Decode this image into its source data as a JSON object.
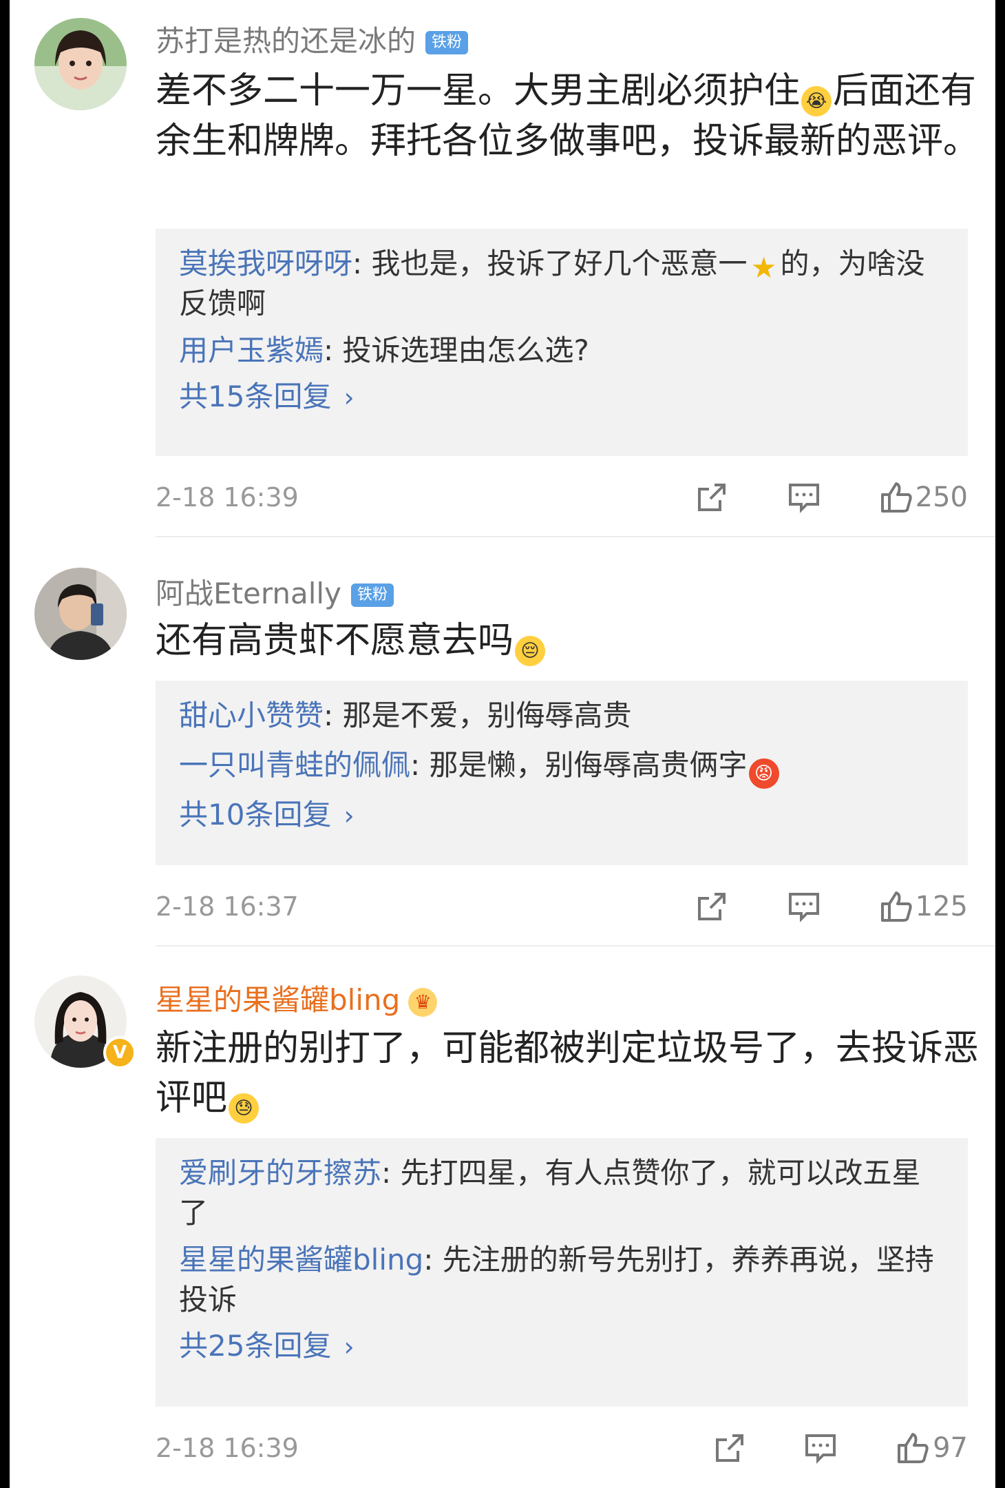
{
  "comments": [
    {
      "username": "苏打是热的还是冰的",
      "badge": "铁粉",
      "text_parts": [
        "差不多二十一万一星。大男主剧必须护住",
        "后面还有余生和牌牌。拜托各位多做事吧，投诉最新的恶评。"
      ],
      "emoji": "crying-emoji",
      "replies": [
        {
          "name": "莫挨我呀呀呀",
          "sep": ": ",
          "text_parts": [
            "我也是，投诉了好几个恶意一",
            "的，为啥没反馈啊"
          ],
          "emoji": "star-icon"
        },
        {
          "name": "用户玉紫嫣",
          "sep": ": ",
          "text": "投诉选理由怎么选?"
        }
      ],
      "more": "共15条回复",
      "time": "2-18 16:39",
      "likes": "250"
    },
    {
      "username": "阿战Eternally",
      "badge": "铁粉",
      "text": "还有高贵虾不愿意去吗",
      "emoji": "sad-emoji",
      "replies": [
        {
          "name": "甜心小赞赞",
          "sep": ": ",
          "text": "那是不爱，别侮辱高贵"
        },
        {
          "name": "一只叫青蛙的佩佩",
          "sep": ": ",
          "text": "那是懒，别侮辱高贵俩字",
          "emoji": "angry-emoji"
        }
      ],
      "more": "共10条回复",
      "time": "2-18 16:37",
      "likes": "125"
    },
    {
      "username": "星星的果酱罐bling",
      "text_parts": [
        "新注册的别打了，可能都被判定垃圾号了，去投诉恶评吧",
        ""
      ],
      "emoji": "sweat-emoji",
      "replies": [
        {
          "name": "爱刷牙的牙擦苏",
          "sep": ": ",
          "text": "先打四星，有人点赞你了，就可以改五星了"
        },
        {
          "name": "星星的果酱罐bling",
          "sep": ": ",
          "text": "先注册的新号先别打，养养再说，坚持投诉"
        }
      ],
      "more": "共25条回复",
      "time": "2-18 16:39",
      "likes": "97"
    }
  ],
  "colors": {
    "username": "#7a7a7a",
    "vip_username": "#e8701f",
    "reply_name": "#4a74b8",
    "fan_badge": "#5aa0e6",
    "reply_bg": "#f2f2f2"
  }
}
